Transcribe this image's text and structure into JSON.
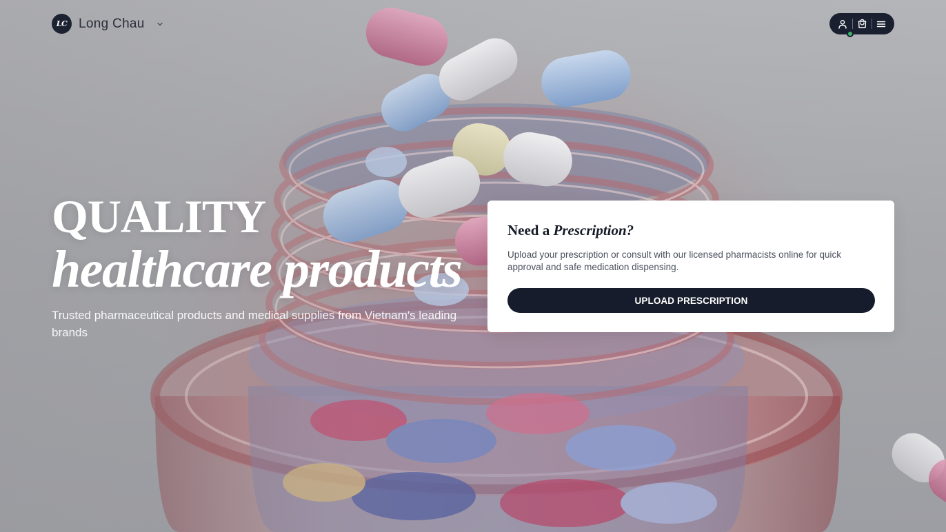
{
  "header": {
    "logo_text": "LC",
    "brand_name": "Long Chau",
    "icons": [
      "user-icon",
      "cart-icon",
      "menu-icon",
      "chevron-down-icon"
    ],
    "status_color": "#3db36b"
  },
  "hero": {
    "title_line1": "QUALITY",
    "title_line2": "healthcare products",
    "subtitle": "Trusted pharmaceutical products and medical supplies from Vietnam's leading brands"
  },
  "prescription_card": {
    "title_prefix": "Need a ",
    "title_emphasis": "Prescription?",
    "description": "Upload your prescription or consult with our licensed pharmacists online for quick approval and safe medication dispensing.",
    "button_label": "UPLOAD PRESCRIPTION"
  },
  "colors": {
    "brand_dark": "#161c2b",
    "card_bg": "#ffffff",
    "hero_text": "#ffffff"
  }
}
